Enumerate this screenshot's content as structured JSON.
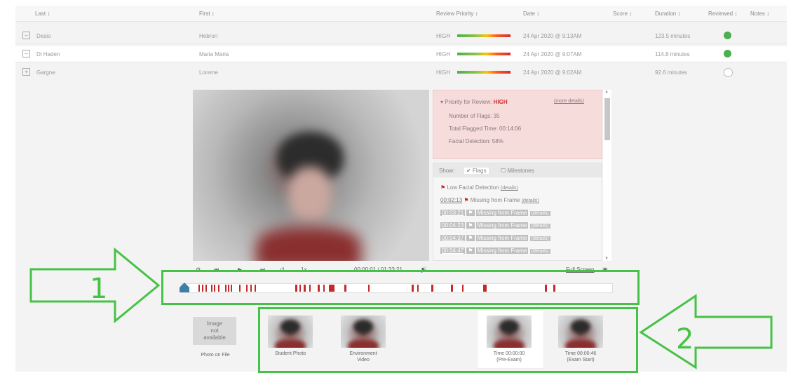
{
  "table": {
    "headers": {
      "last": "Last ↕",
      "first": "First ↕",
      "priority": "Review Priority ↕",
      "date": "Date ↕",
      "score": "Score ↕",
      "duration": "Duration ↕",
      "reviewed": "Reviewed ↕",
      "notes": "Notes ↕"
    },
    "rows": [
      {
        "last": "Desio",
        "first": "Hebron",
        "priority": "HIGH",
        "date": "24 Apr 2020 @ 9:13AM",
        "duration": "123.5 minutes",
        "reviewed": true,
        "expand": "−"
      },
      {
        "last": "Di Haden",
        "first": "Maria Maria",
        "priority": "HIGH",
        "date": "24 Apr 2020 @ 9:07AM",
        "duration": "114.8 minutes",
        "reviewed": true,
        "expand": "−"
      },
      {
        "last": "Gargne",
        "first": "Loreme",
        "priority": "HIGH",
        "date": "24 Apr 2020 @ 9:02AM",
        "duration": "92.6 minutes",
        "reviewed": false,
        "expand": "+"
      }
    ],
    "colors": {
      "reviewed": "#4caf50"
    }
  },
  "summary": {
    "priority_label": "Priority for Review:",
    "priority_value": "HIGH",
    "more_link": "(more details)",
    "flags": "Number of Flags: 35",
    "flagged_time": "Total Flagged Time: 00:14:06",
    "facial": "Facial Detection: 58%"
  },
  "flag_panel": {
    "show": "Show:",
    "tab_flags": "✔ Flags",
    "tab_milestones": "☐ Milestones",
    "low_facial": "Low Facial Detection",
    "low_facial_link": "(details)",
    "items": [
      {
        "time": "00:02:13",
        "label": "Missing from Frame",
        "link": "(details)",
        "highlight": false
      },
      {
        "time": "00:03:21",
        "label": "Missing from Frame",
        "link": "(details)",
        "highlight": true
      },
      {
        "time": "00:04:23",
        "label": "Missing from Frame",
        "link": "(details)",
        "highlight": true
      },
      {
        "time": "00:04:37",
        "label": "Missing from Frame",
        "link": "(details)",
        "highlight": true
      },
      {
        "time": "00:04:47",
        "label": "Missing from Frame",
        "link": "(details)",
        "highlight": true
      }
    ],
    "flag_color": "#c9232c"
  },
  "player": {
    "time_display": "00:00:01 / 01:33:21",
    "speed": "1x",
    "fullscreen_link": "Full Screen",
    "markers_color": "#c62828"
  },
  "thumbnails": {
    "no_image": "Image\nnot\navailable",
    "photo_on_file": "Photo on File",
    "items": [
      {
        "caption": "Student Photo"
      },
      {
        "caption": "Environment\nVideo"
      },
      {
        "caption": "Time 00:00:00\n(Pre-Exam)"
      },
      {
        "caption": "Time 00:00:46\n(Exam Start)"
      }
    ]
  },
  "annotations": {
    "one": "1",
    "two": "2",
    "color": "#46c246"
  }
}
